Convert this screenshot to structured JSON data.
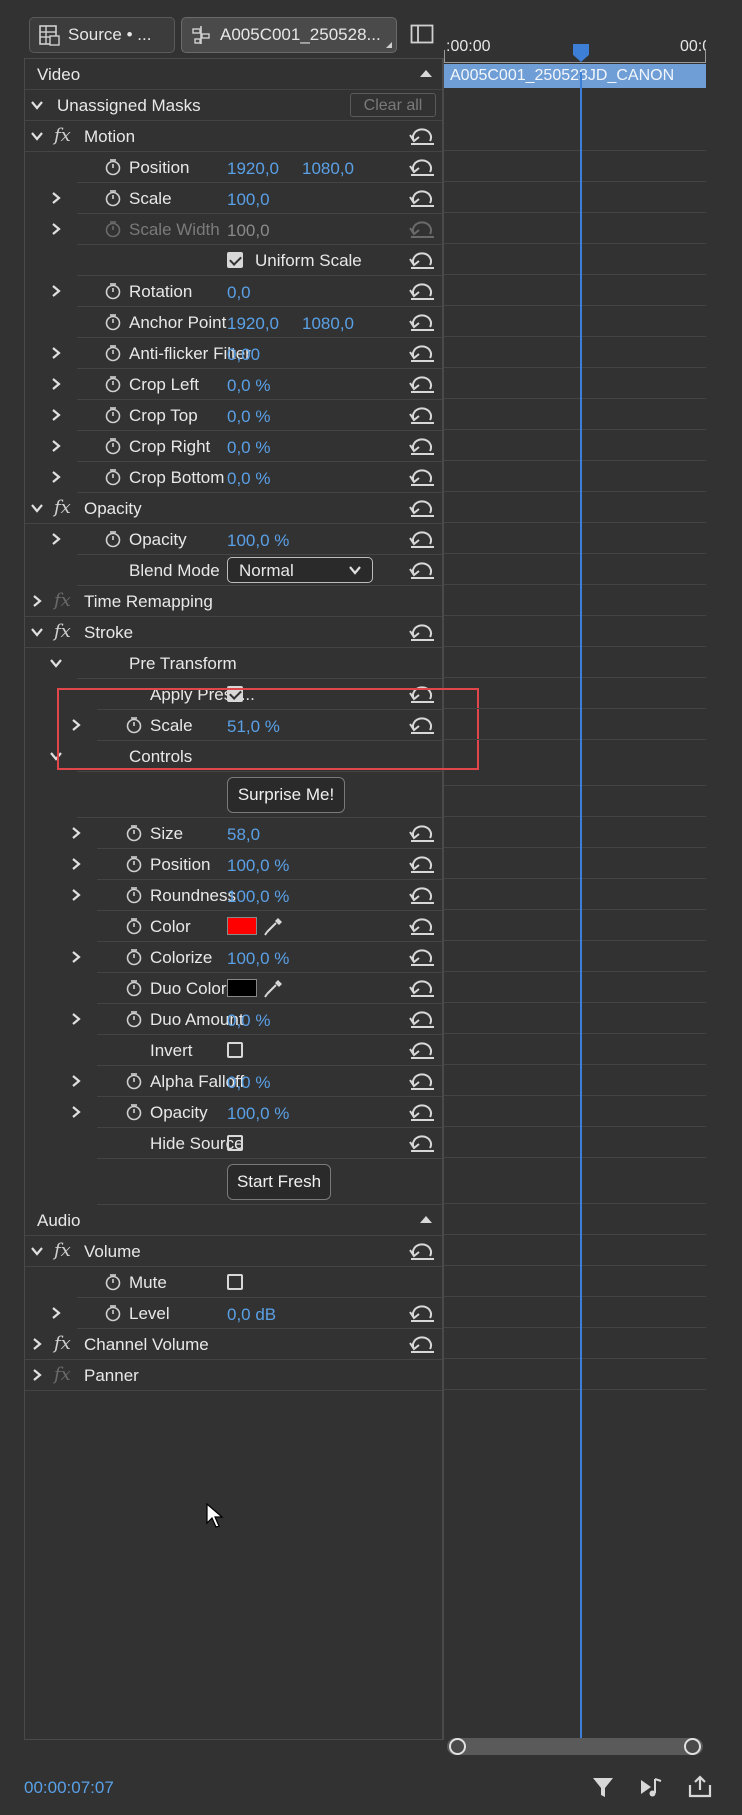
{
  "tabs": {
    "source_label": "Source • ...",
    "clip_label": "A005C001_250528..."
  },
  "sections": {
    "video": "Video",
    "audio": "Audio"
  },
  "masks": {
    "label": "Unassigned Masks",
    "clear_all": "Clear all"
  },
  "motion": {
    "label": "Motion",
    "position": {
      "label": "Position",
      "x": "1920,0",
      "y": "1080,0"
    },
    "scale": {
      "label": "Scale",
      "value": "100,0"
    },
    "scale_width": {
      "label": "Scale Width",
      "value": "100,0"
    },
    "uniform_scale": {
      "label": "Uniform Scale",
      "checked": true
    },
    "rotation": {
      "label": "Rotation",
      "value": "0,0"
    },
    "anchor_point": {
      "label": "Anchor Point",
      "x": "1920,0",
      "y": "1080,0"
    },
    "anti_flicker": {
      "label": "Anti-flicker Filter",
      "value": "0,00"
    },
    "crop_left": {
      "label": "Crop Left",
      "value": "0,0 %"
    },
    "crop_top": {
      "label": "Crop Top",
      "value": "0,0 %"
    },
    "crop_right": {
      "label": "Crop Right",
      "value": "0,0 %"
    },
    "crop_bottom": {
      "label": "Crop Bottom",
      "value": "0,0 %"
    }
  },
  "opacity": {
    "label": "Opacity",
    "opacity": {
      "label": "Opacity",
      "value": "100,0 %"
    },
    "blend_mode": {
      "label": "Blend Mode",
      "value": "Normal"
    }
  },
  "time_remapping": {
    "label": "Time Remapping"
  },
  "stroke": {
    "label": "Stroke",
    "pre_transform": "Pre Transform",
    "apply_preset": {
      "label": "Apply Presc...",
      "checked": true
    },
    "scale": {
      "label": "Scale",
      "value": "51,0 %"
    },
    "controls": "Controls",
    "surprise_button": "Surprise Me!",
    "size": {
      "label": "Size",
      "value": "58,0"
    },
    "position": {
      "label": "Position",
      "value": "100,0 %"
    },
    "roundness": {
      "label": "Roundness",
      "value": "100,0 %"
    },
    "color": {
      "label": "Color",
      "swatch": "#ff0000"
    },
    "colorize": {
      "label": "Colorize",
      "value": "100,0 %"
    },
    "duo_color": {
      "label": "Duo Color",
      "swatch": "#000000"
    },
    "duo_amount": {
      "label": "Duo Amount",
      "value": "0,0 %"
    },
    "invert": {
      "label": "Invert",
      "checked": false
    },
    "alpha_falloff": {
      "label": "Alpha Falloff",
      "value": "0,0 %"
    },
    "opacity": {
      "label": "Opacity",
      "value": "100,0 %"
    },
    "hide_source": {
      "label": "Hide Source",
      "checked": false
    },
    "start_fresh_button": "Start Fresh"
  },
  "volume": {
    "label": "Volume",
    "mute": {
      "label": "Mute",
      "checked": false
    },
    "level": {
      "label": "Level",
      "value": "0,0 dB"
    }
  },
  "channel_volume": {
    "label": "Channel Volume"
  },
  "panner": {
    "label": "Panner"
  },
  "timeline": {
    "ruler_start": ":00:00",
    "ruler_end": "00:0",
    "clip_name": "A005C001_250528JD_CANON"
  },
  "status": {
    "timecode": "00:00:07:07"
  },
  "colors": {
    "accent": "#5aa0e6",
    "playhead": "#3d7fd6",
    "clip": "#6f9ed6",
    "highlight": "#e0464a"
  }
}
